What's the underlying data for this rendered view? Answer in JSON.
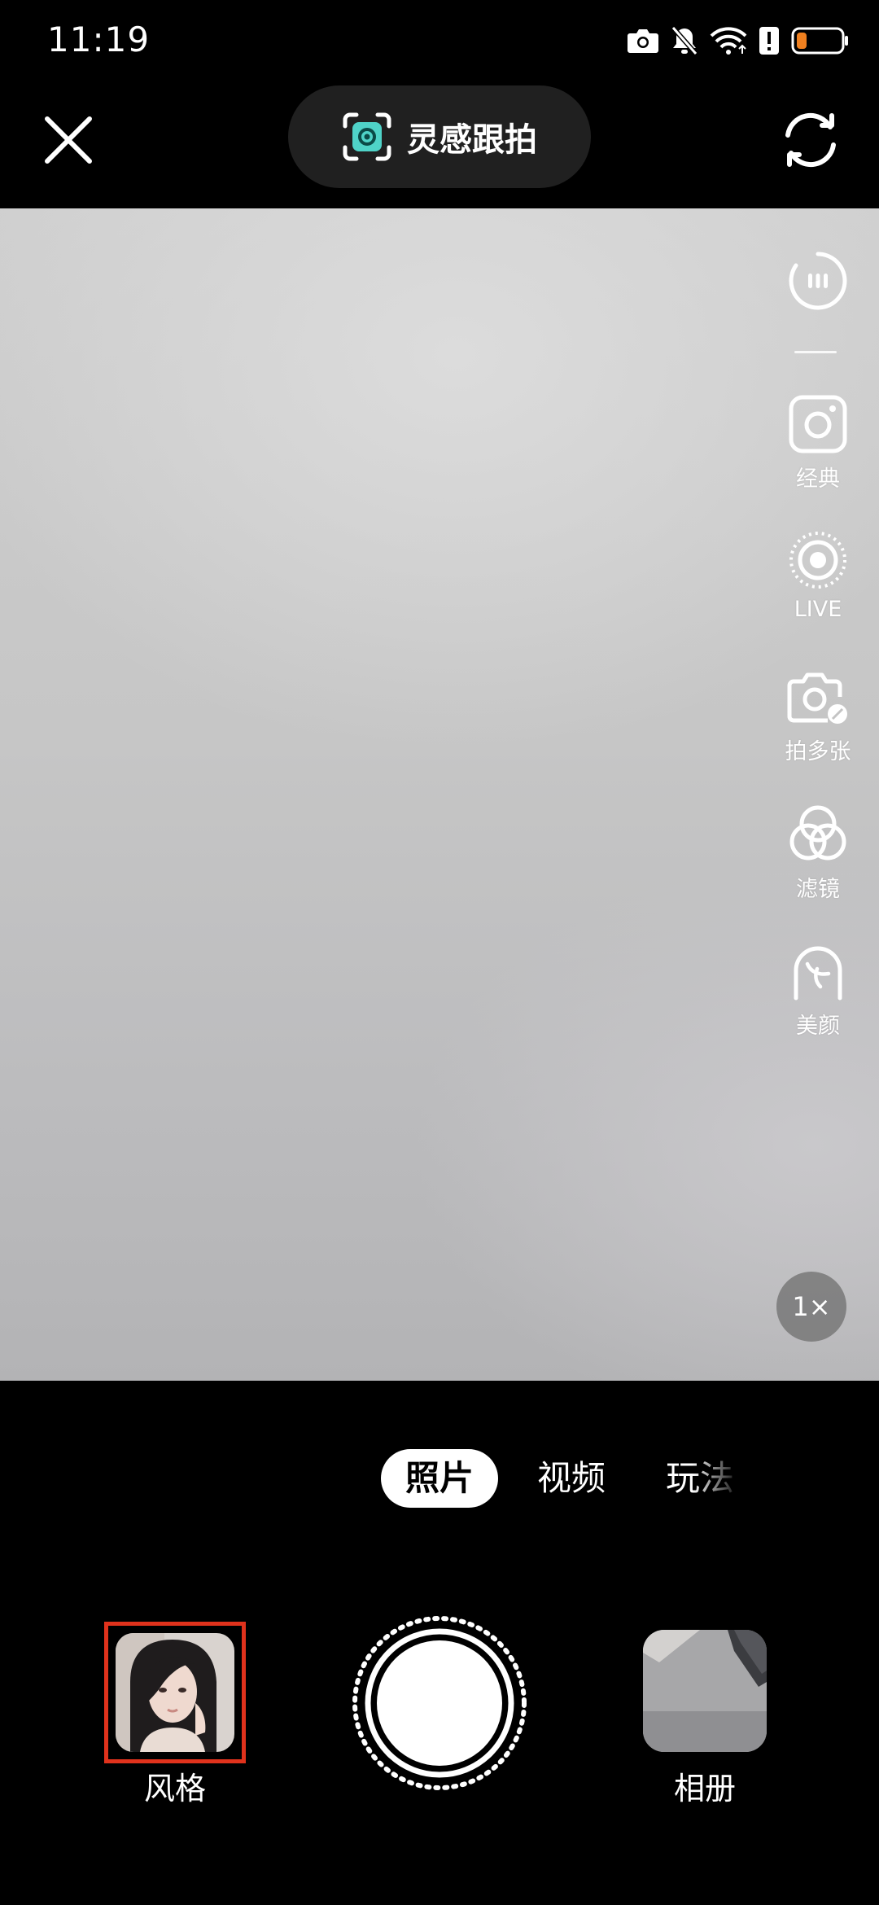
{
  "status_bar": {
    "time": "11:19",
    "icons": [
      "camera-icon",
      "bell-muted-icon",
      "wifi-icon",
      "alert-icon",
      "battery-low-icon"
    ],
    "battery_color": "#f0801f"
  },
  "top_bar": {
    "close_icon": "close-icon",
    "mode_label": "灵感跟拍",
    "mode_icon": "inspiration-icon",
    "mode_icon_color": "#4fd3c8",
    "flip_icon": "flip-camera-icon"
  },
  "side_tools": {
    "items": [
      {
        "name": "more",
        "label": "",
        "icon": "more-icon"
      },
      {
        "name": "classic",
        "label": "经典",
        "icon": "classic-frame-icon"
      },
      {
        "name": "live",
        "label": "LIVE",
        "icon": "live-icon"
      },
      {
        "name": "multi",
        "label": "拍多张",
        "icon": "multi-shot-icon"
      },
      {
        "name": "filter",
        "label": "滤镜",
        "icon": "filter-icon"
      },
      {
        "name": "beauty",
        "label": "美颜",
        "icon": "beauty-icon"
      }
    ]
  },
  "zoom": {
    "label": "1×"
  },
  "mode_tabs": [
    {
      "label": "照片",
      "active": true
    },
    {
      "label": "视频",
      "active": false
    },
    {
      "label": "玩法",
      "active": false
    }
  ],
  "bottom": {
    "style_label": "风格",
    "album_label": "相册",
    "style_highlight_color": "#e0321c"
  }
}
